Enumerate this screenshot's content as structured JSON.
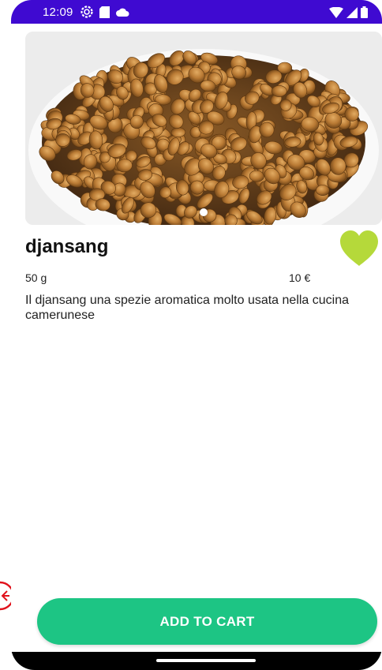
{
  "status_bar": {
    "time": "12:09",
    "left_icons": [
      "settings-icon",
      "sim-card-icon",
      "cloud-icon"
    ],
    "right_icons": [
      "wifi-icon",
      "signal-icon",
      "battery-icon"
    ],
    "color": "#3f0ad1"
  },
  "product": {
    "image": "bowl of djansang seeds",
    "carousel_pages": 1,
    "carousel_active_index": 0,
    "name": "djansang",
    "weight": "50 g",
    "price": "10 €",
    "description": "Il djansang  una spezie aromatica molto usata nella cucina camerunese",
    "favorite": true,
    "favorite_color": "#b5d93a"
  },
  "actions": {
    "add_to_cart_label": "ADD TO CART",
    "button_color": "#1dc584"
  }
}
